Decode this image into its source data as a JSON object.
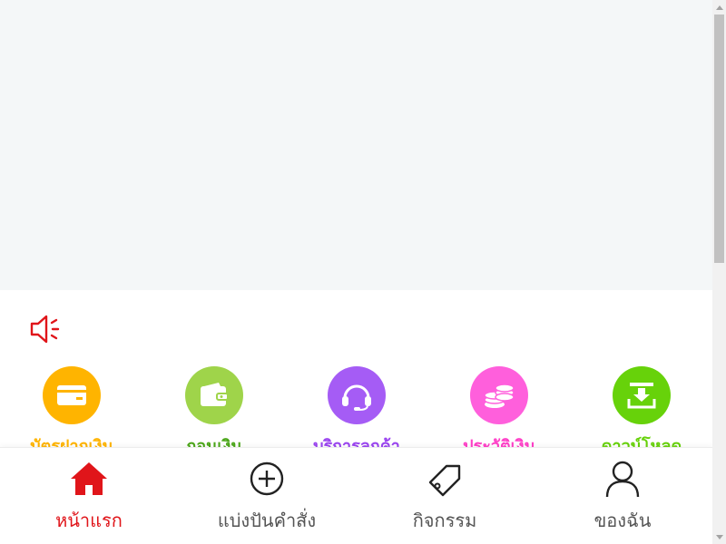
{
  "colors": {
    "accent": "#e0151a",
    "banner_bg": "#f4f7f8",
    "tab_inactive": "#555555"
  },
  "notice": {
    "icon": "speaker-icon"
  },
  "quick_menu": [
    {
      "icon": "card-icon",
      "label": "บัตรฝากเงิน",
      "color": "#ffb400",
      "label_color": "#ffb400"
    },
    {
      "icon": "wallet-icon",
      "label": "ถอนเงิน",
      "color": "#9fd44a",
      "label_color": "#4ca71a"
    },
    {
      "icon": "headset-icon",
      "label": "บริการลูกค้า",
      "color": "#a55cf5",
      "label_color": "#9b45f0"
    },
    {
      "icon": "coins-icon",
      "label": "ประวัติเงิน",
      "color": "#ff5fdc",
      "label_color": "#ff3fc8"
    },
    {
      "icon": "download-icon",
      "label": "ดาวน์โหลด",
      "color": "#67d20a",
      "label_color": "#67d20a"
    }
  ],
  "tabbar": {
    "items": [
      {
        "icon": "home-icon",
        "label": "หน้าแรก",
        "active": true
      },
      {
        "icon": "plus-circle-icon",
        "label": "แบ่งปันคำสั่ง",
        "active": false
      },
      {
        "icon": "tag-icon",
        "label": "กิจกรรม",
        "active": false
      },
      {
        "icon": "user-icon",
        "label": "ของฉัน",
        "active": false
      }
    ]
  }
}
